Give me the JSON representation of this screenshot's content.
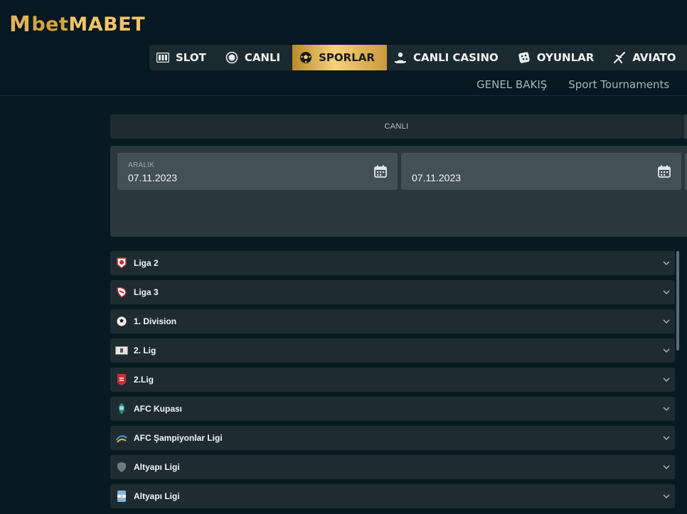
{
  "brand": {
    "logo_text": "MbetMABET"
  },
  "nav": [
    {
      "label": "SLOT",
      "icon": "slot-machine-icon",
      "active": false
    },
    {
      "label": "CANLI",
      "icon": "live-dot-icon",
      "active": false
    },
    {
      "label": "SPORLAR",
      "icon": "soccer-ball-icon",
      "active": true
    },
    {
      "label": "CANLI CASINO",
      "icon": "dealer-icon",
      "active": false
    },
    {
      "label": "OYUNLAR",
      "icon": "dice-icon",
      "active": false
    },
    {
      "label": "AVIATO",
      "icon": "plane-icon",
      "active": false
    }
  ],
  "subnav": {
    "overview": "GENEL BAKIŞ",
    "tournaments": "Sport Tournaments"
  },
  "canli_tab": "CANLI",
  "date_filter": {
    "from_label": "ARALIK",
    "from_value": "07.11.2023",
    "to_value": "07.11.2023"
  },
  "leagues": [
    {
      "name": "Liga 2",
      "icon": "liga2-logo-icon"
    },
    {
      "name": "Liga 3",
      "icon": "liga3-logo-icon"
    },
    {
      "name": "1. Division",
      "icon": "football-icon"
    },
    {
      "name": "2. Lig",
      "icon": "lig-badge-icon"
    },
    {
      "name": "2.Lig",
      "icon": "red-badge-icon"
    },
    {
      "name": "AFC Kupası",
      "icon": "afc-cup-icon"
    },
    {
      "name": "AFC Şampiyonlar Ligi",
      "icon": "afc-champions-icon"
    },
    {
      "name": "Altyapı Ligi",
      "icon": "shield-icon"
    },
    {
      "name": "Altyapı Ligi",
      "icon": "argentina-badge-icon"
    }
  ],
  "colors": {
    "accent_gold": "#d6a542",
    "background": "#071a22",
    "row_bg": "#1e2c32"
  }
}
